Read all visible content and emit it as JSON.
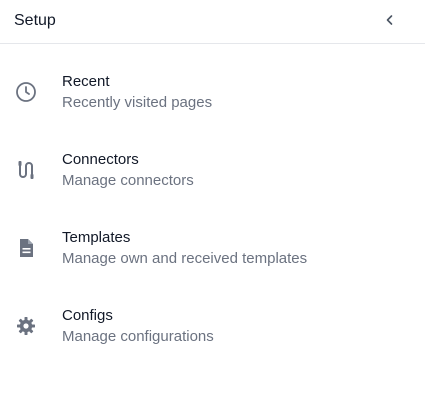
{
  "header": {
    "title": "Setup",
    "collapse_icon": "chevron-left-icon"
  },
  "items": [
    {
      "label": "Recent",
      "description": "Recently visited pages",
      "icon": "clock-icon"
    },
    {
      "label": "Connectors",
      "description": "Manage connectors",
      "icon": "connector-icon"
    },
    {
      "label": "Templates",
      "description": "Manage own and received templates",
      "icon": "document-icon"
    },
    {
      "label": "Configs",
      "description": "Manage configurations",
      "icon": "gear-icon"
    }
  ],
  "colors": {
    "icon": "#6b7280",
    "title": "#111827",
    "description": "#6b7280",
    "divider": "#e5e7eb"
  }
}
